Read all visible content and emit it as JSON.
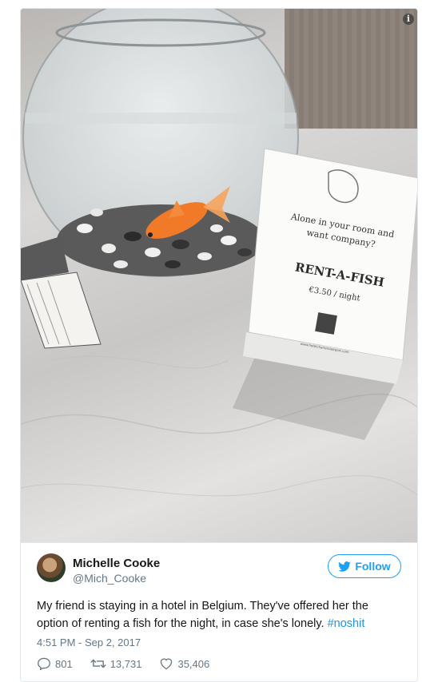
{
  "tweet": {
    "author_name": "Michelle Cooke",
    "author_handle": "@Mich_Cooke",
    "follow_label": "Follow",
    "text": "My friend is staying in a hotel in Belgium. They've offered her the option of renting a fish for the night, in case she's lonely.",
    "hashtag": "#noshit",
    "timestamp": "4:51 PM - Sep 2, 2017",
    "replies": "801",
    "retweets": "13,731",
    "likes": "35,406"
  },
  "photo": {
    "sign_line1": "Alone in your room and",
    "sign_line2": "want company?",
    "sign_title": "RENT-A-FISH",
    "sign_price": "€3.50 / night",
    "sign_url": "www.hotelcharleroiairport.com",
    "info_icon": "i"
  },
  "colors": {
    "accent": "#1da1f2",
    "hashtag": "#1b95e0",
    "secondary_text": "#657786",
    "primary_text": "#14171a"
  }
}
